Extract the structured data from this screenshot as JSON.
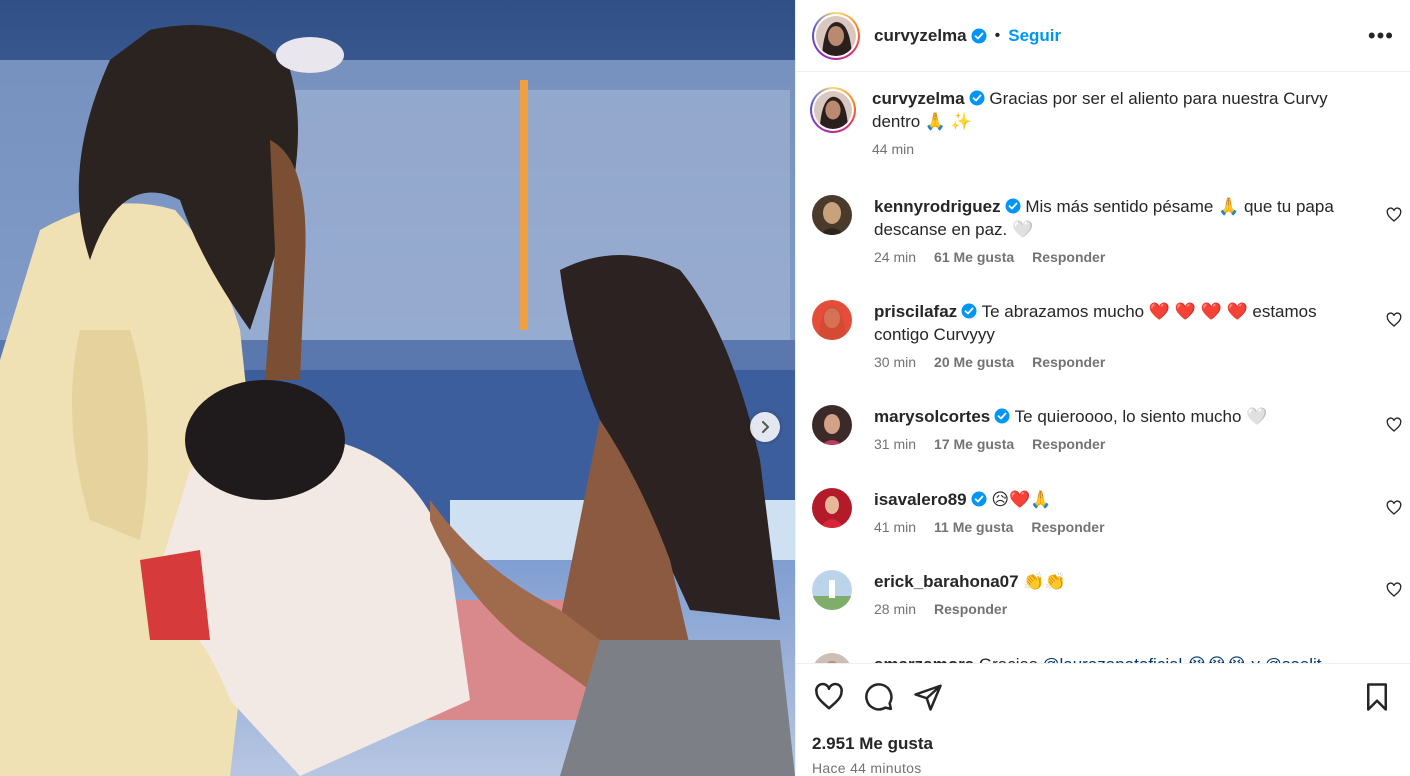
{
  "post": {
    "username": "curvyzelma",
    "follow_label": "Seguir",
    "more_label": "•••",
    "caption_text": "Gracias por ser el aliento para nuestra Curvy dentro 🙏 ✨",
    "caption_time": "44 min",
    "likes": "2.951 Me gusta",
    "timestamp": "Hace 44 minutos"
  },
  "comments": [
    {
      "user": "kennyrodriguez",
      "text": "Mis más sentido pésame 🙏 que tu papa descanse en paz. 🤍",
      "time": "24 min",
      "likes": "61 Me gusta",
      "reply": "Responder"
    },
    {
      "user": "priscilafaz",
      "text": "Te abrazamos mucho ❤️ ❤️ ❤️ ❤️ estamos contigo Curvyyy",
      "time": "30 min",
      "likes": "20 Me gusta",
      "reply": "Responder"
    },
    {
      "user": "marysolcortes",
      "text": "Te quieroooo, lo siento mucho 🤍",
      "time": "31 min",
      "likes": "17 Me gusta",
      "reply": "Responder"
    },
    {
      "user": "isavalero89",
      "text": "😥❤️🙏",
      "time": "41 min",
      "likes": "11 Me gusta",
      "reply": "Responder"
    },
    {
      "user": "erick_barahona07",
      "text": "👏👏",
      "time": "28 min",
      "likes": "",
      "reply": "Responder"
    },
    {
      "user": "amarzamora",
      "text": "Gracias",
      "mention": "@laurazapatoficial 😭😭😭 y @soelit...",
      "time": "",
      "likes": "",
      "reply": ""
    }
  ],
  "icons": {
    "like": "heart-icon",
    "comment": "comment-icon",
    "share": "share-icon",
    "save": "bookmark-icon",
    "verified": "verified-badge-icon",
    "next": "chevron-right-icon"
  },
  "colors": {
    "accent": "#0095f6",
    "verified": "#0095f6",
    "text": "#262626",
    "muted": "#737373"
  }
}
